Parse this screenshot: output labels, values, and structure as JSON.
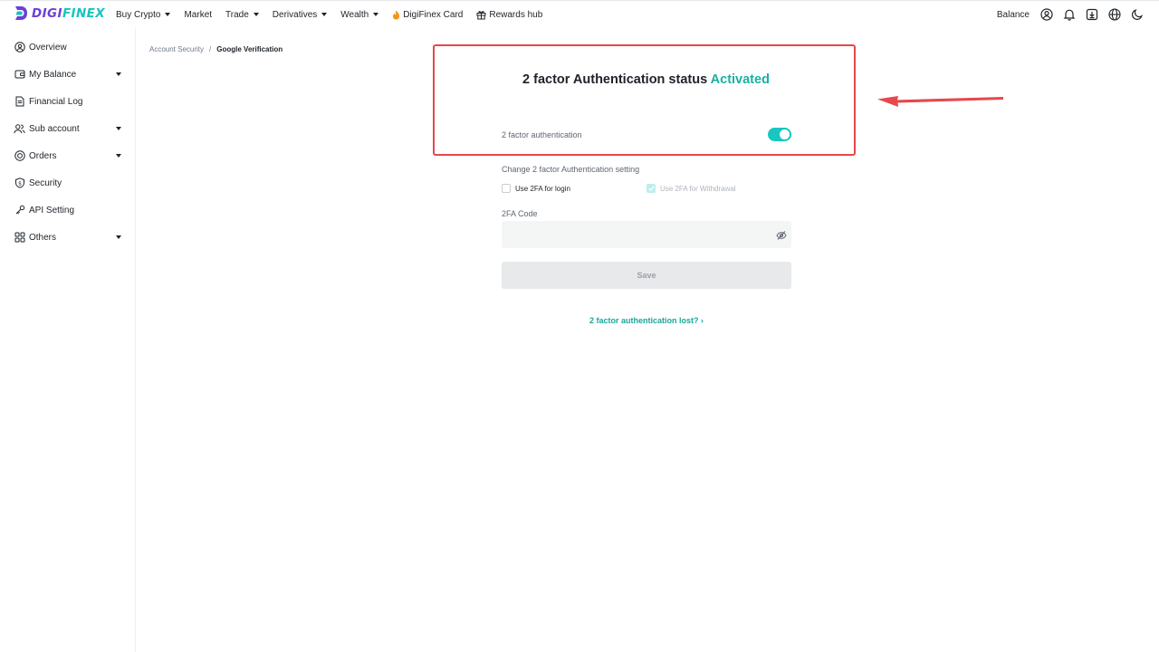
{
  "brand": {
    "logo_a": "DIGI",
    "logo_b": "FINEX",
    "purple": "#6a3fd8",
    "teal": "#18c3c0"
  },
  "nav": {
    "items": [
      {
        "label": "Buy Crypto",
        "dropdown": true
      },
      {
        "label": "Market",
        "dropdown": false
      },
      {
        "label": "Trade",
        "dropdown": true
      },
      {
        "label": "Derivatives",
        "dropdown": true
      },
      {
        "label": "Wealth",
        "dropdown": true
      },
      {
        "label": "DigiFinex Card",
        "icon": "fire-icon",
        "dropdown": false
      },
      {
        "label": "Rewards hub",
        "icon": "gift-icon",
        "dropdown": false
      }
    ],
    "balance_label": "Balance",
    "right_icons": [
      "user-icon",
      "bell-icon",
      "download-icon",
      "globe-icon",
      "moon-icon"
    ]
  },
  "sidebar": {
    "items": [
      {
        "label": "Overview",
        "icon": "user-circle-icon",
        "expandable": false
      },
      {
        "label": "My Balance",
        "icon": "wallet-icon",
        "expandable": true
      },
      {
        "label": "Financial Log",
        "icon": "document-icon",
        "expandable": false
      },
      {
        "label": "Sub account",
        "icon": "users-icon",
        "expandable": true
      },
      {
        "label": "Orders",
        "icon": "orders-icon",
        "expandable": true
      },
      {
        "label": "Security",
        "icon": "shield-icon",
        "expandable": false
      },
      {
        "label": "API Setting",
        "icon": "api-icon",
        "expandable": false
      },
      {
        "label": "Others",
        "icon": "grid-icon",
        "expandable": true
      }
    ]
  },
  "breadcrumb": {
    "parent": "Account Security",
    "separator": "/",
    "current": "Google Verification"
  },
  "status": {
    "title_prefix": "2 factor Authentication status",
    "title_status": "Activated",
    "toggle_label": "2 factor authentication",
    "toggle_on": true,
    "accent": "#17b1a4"
  },
  "settings": {
    "change_label": "Change 2 factor Authentication setting",
    "use_login_label": "Use 2FA for login",
    "use_login_checked": false,
    "use_withdrawal_label": "Use 2FA for Withdrawal",
    "use_withdrawal_checked": true,
    "code_label": "2FA Code",
    "code_value": "",
    "code_placeholder": "",
    "save_label": "Save",
    "lost_link": "2 factor authentication lost? ›"
  },
  "annotation": {
    "highlight_color": "#e5484d"
  }
}
